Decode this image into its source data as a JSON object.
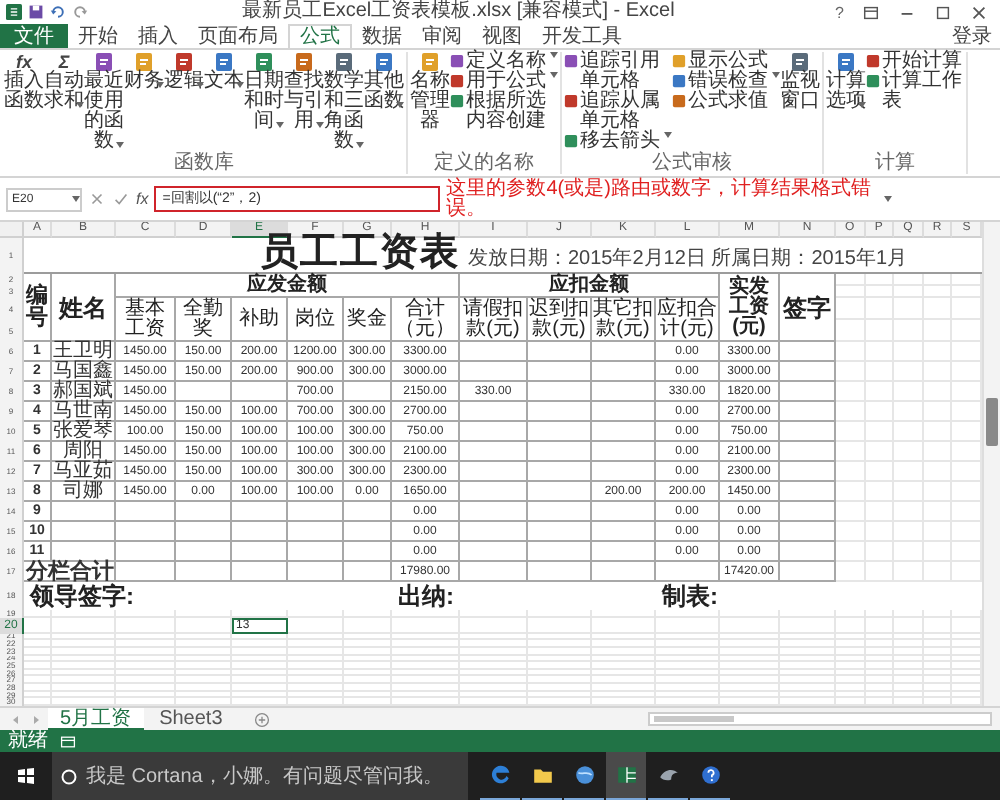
{
  "window": {
    "title": "最新员工Excel工资表模板.xlsx [兼容模式] - Excel",
    "help": "?"
  },
  "ribbon": {
    "tabs": [
      {
        "label": "文件",
        "kind": "file",
        "selected": false
      },
      {
        "label": "开始",
        "kind": "tab",
        "selected": false
      },
      {
        "label": "插入",
        "kind": "tab",
        "selected": false
      },
      {
        "label": "页面布局",
        "kind": "tab",
        "selected": false
      },
      {
        "label": "公式",
        "kind": "tab",
        "selected": true
      },
      {
        "label": "数据",
        "kind": "tab",
        "selected": false
      },
      {
        "label": "审阅",
        "kind": "tab",
        "selected": false
      },
      {
        "label": "视图",
        "kind": "tab",
        "selected": false
      },
      {
        "label": "开发工具",
        "kind": "tab",
        "selected": false
      }
    ],
    "sign_in": "登录",
    "groups": [
      {
        "label": "函数库",
        "items": [
          {
            "kind": "large",
            "label": "插入函数",
            "glyph": "fx",
            "dropdown": false
          },
          {
            "kind": "large",
            "label": "自动求和",
            "glyph": "Σ",
            "dropdown": true
          },
          {
            "kind": "large",
            "label": "最近使用的函数",
            "dropdown": true
          },
          {
            "kind": "large",
            "label": "财务",
            "dropdown": true
          },
          {
            "kind": "large",
            "label": "逻辑",
            "dropdown": true
          },
          {
            "kind": "large",
            "label": "文本",
            "dropdown": true
          },
          {
            "kind": "large",
            "label": "日期和时间",
            "dropdown": true
          },
          {
            "kind": "large",
            "label": "查找与引用",
            "dropdown": true
          },
          {
            "kind": "large",
            "label": "数学和三角函数",
            "dropdown": true
          },
          {
            "kind": "large",
            "label": "其他函数",
            "dropdown": true
          }
        ]
      },
      {
        "label": "定义的名称",
        "items": [
          {
            "kind": "large",
            "label": "名称管理器",
            "dropdown": false
          },
          {
            "kind": "small",
            "label": "定义名称",
            "dropdown": true
          },
          {
            "kind": "small",
            "label": "用于公式",
            "dropdown": true
          },
          {
            "kind": "small",
            "label": "根据所选内容创建",
            "dropdown": false
          }
        ]
      },
      {
        "label": "公式审核",
        "items": [
          {
            "kind": "small",
            "label": "追踪引用单元格",
            "dropdown": false
          },
          {
            "kind": "small",
            "label": "追踪从属单元格",
            "dropdown": false
          },
          {
            "kind": "small",
            "label": "移去箭头",
            "dropdown": true
          },
          {
            "kind": "small",
            "label": "显示公式",
            "dropdown": false
          },
          {
            "kind": "small",
            "label": "错误检查",
            "dropdown": true
          },
          {
            "kind": "small",
            "label": "公式求值",
            "dropdown": false
          },
          {
            "kind": "large",
            "label": "监视窗口",
            "dropdown": false
          }
        ]
      },
      {
        "label": "计算",
        "items": [
          {
            "kind": "large",
            "label": "计算选项",
            "dropdown": true
          },
          {
            "kind": "small",
            "label": "开始计算",
            "dropdown": false
          },
          {
            "kind": "small",
            "label": "计算工作表",
            "dropdown": false
          }
        ]
      }
    ]
  },
  "formula_bar": {
    "name_box": "E20",
    "fx": "fx",
    "formula": "=回割以(“2”，2)",
    "note": "这里的参数4(或是)路由或数字，计算结果格式错误。"
  },
  "sheet": {
    "columns": [
      {
        "label": "A",
        "selected": false
      },
      {
        "label": "B",
        "selected": false
      },
      {
        "label": "C",
        "selected": false
      },
      {
        "label": "D",
        "selected": false
      },
      {
        "label": "E",
        "selected": true
      },
      {
        "label": "F",
        "selected": false
      },
      {
        "label": "G",
        "selected": false
      },
      {
        "label": "H",
        "selected": false
      },
      {
        "label": "I",
        "selected": false
      },
      {
        "label": "J",
        "selected": false
      },
      {
        "label": "K",
        "selected": false
      },
      {
        "label": "L",
        "selected": false
      },
      {
        "label": "M",
        "selected": false
      },
      {
        "label": "N",
        "selected": false
      },
      {
        "label": "O",
        "selected": false
      },
      {
        "label": "P",
        "selected": false
      },
      {
        "label": "Q",
        "selected": false
      },
      {
        "label": "R",
        "selected": false
      },
      {
        "label": "S",
        "selected": false
      }
    ],
    "row_numbers": [
      {
        "label": "1",
        "selected": false
      },
      {
        "label": "2",
        "selected": false
      },
      {
        "label": "3",
        "selected": false
      },
      {
        "label": "4",
        "selected": false
      },
      {
        "label": "5",
        "selected": false
      },
      {
        "label": "6",
        "selected": false
      },
      {
        "label": "7",
        "selected": false
      },
      {
        "label": "8",
        "selected": false
      },
      {
        "label": "9",
        "selected": false
      },
      {
        "label": "10",
        "selected": false
      },
      {
        "label": "11",
        "selected": false
      },
      {
        "label": "12",
        "selected": false
      },
      {
        "label": "13",
        "selected": false
      },
      {
        "label": "14",
        "selected": false
      },
      {
        "label": "15",
        "selected": false
      },
      {
        "label": "16",
        "selected": false
      },
      {
        "label": "17",
        "selected": false
      },
      {
        "label": "18",
        "selected": false
      },
      {
        "label": "19",
        "selected": false
      },
      {
        "label": "20",
        "selected": true
      },
      {
        "label": "21",
        "selected": false
      },
      {
        "label": "22",
        "selected": false
      },
      {
        "label": "23",
        "selected": false
      },
      {
        "label": "24",
        "selected": false
      },
      {
        "label": "25",
        "selected": false
      },
      {
        "label": "26",
        "selected": false
      },
      {
        "label": "27",
        "selected": false
      },
      {
        "label": "28",
        "selected": false
      },
      {
        "label": "29",
        "selected": false
      },
      {
        "label": "30",
        "selected": false
      }
    ],
    "title": "员工工资表",
    "date_line": "发放日期：2015年2月12日 所属日期：2015年1月",
    "header": {
      "number": "编号",
      "name": "姓名",
      "groups": [
        {
          "label": "应发金额",
          "columns": [
            "基本工资",
            "全勤奖",
            "补助",
            "岗位",
            "奖金",
            "合计（元）"
          ]
        },
        {
          "label": "应扣金额",
          "columns": [
            "请假扣款(元)",
            "迟到扣款(元)",
            "其它扣款(元)",
            "应扣合计(元)"
          ]
        }
      ],
      "net_pay": "实发工资(元)",
      "signature": "签字"
    },
    "rows": [
      {
        "cells": [
          "1",
          "王卫明",
          "1450.00",
          "150.00",
          "200.00",
          "1200.00",
          "300.00",
          "3300.00",
          null,
          null,
          null,
          "0.00",
          "3300.00",
          null
        ]
      },
      {
        "cells": [
          "2",
          "马国鑫",
          "1450.00",
          "150.00",
          "200.00",
          "900.00",
          "300.00",
          "3000.00",
          null,
          null,
          null,
          "0.00",
          "3000.00",
          null
        ]
      },
      {
        "cells": [
          "3",
          "郝国斌",
          "1450.00",
          null,
          null,
          "700.00",
          null,
          "2150.00",
          "330.00",
          null,
          null,
          "330.00",
          "1820.00",
          null
        ]
      },
      {
        "cells": [
          "4",
          "马世南",
          "1450.00",
          "150.00",
          "100.00",
          "700.00",
          "300.00",
          "2700.00",
          null,
          null,
          null,
          "0.00",
          "2700.00",
          null
        ]
      },
      {
        "cells": [
          "5",
          "张爱琴",
          "100.00",
          "150.00",
          "100.00",
          "100.00",
          "300.00",
          "750.00",
          null,
          null,
          null,
          "0.00",
          "750.00",
          null
        ]
      },
      {
        "cells": [
          "6",
          "周阳",
          "1450.00",
          "150.00",
          "100.00",
          "100.00",
          "300.00",
          "2100.00",
          null,
          null,
          null,
          "0.00",
          "2100.00",
          null
        ]
      },
      {
        "cells": [
          "7",
          "马亚茹",
          "1450.00",
          "150.00",
          "100.00",
          "300.00",
          "300.00",
          "2300.00",
          null,
          null,
          null,
          "0.00",
          "2300.00",
          null
        ]
      },
      {
        "cells": [
          "8",
          "司娜",
          "1450.00",
          "0.00",
          "100.00",
          "100.00",
          "0.00",
          "1650.00",
          null,
          null,
          "200.00",
          "200.00",
          "1450.00",
          null
        ]
      },
      {
        "cells": [
          "9",
          null,
          null,
          null,
          null,
          null,
          null,
          "0.00",
          null,
          null,
          null,
          "0.00",
          "0.00",
          null
        ]
      },
      {
        "cells": [
          "10",
          null,
          null,
          null,
          null,
          null,
          null,
          "0.00",
          null,
          null,
          null,
          "0.00",
          "0.00",
          null
        ]
      },
      {
        "cells": [
          "11",
          null,
          null,
          null,
          null,
          null,
          null,
          "0.00",
          null,
          null,
          null,
          "0.00",
          "0.00",
          null
        ]
      }
    ],
    "totals": {
      "label": "分栏合计",
      "cells": [
        null,
        null,
        null,
        null,
        null,
        "17980.00",
        null,
        null,
        null,
        null,
        "17420.00",
        null
      ]
    },
    "signatures": [
      "领导签字:",
      "出纳:",
      "制表:"
    ],
    "active_value": "13"
  },
  "sheet_tabs": [
    {
      "label": "5月工资",
      "selected": true
    },
    {
      "label": "Sheet3",
      "selected": false
    }
  ],
  "status": "就绪",
  "taskbar": {
    "search_placeholder": "我是 Cortana，小娜。有问题尽管问我。",
    "apps": [
      {
        "selected": false
      },
      {
        "selected": false
      },
      {
        "selected": false
      },
      {
        "selected": true
      },
      {
        "selected": false
      },
      {
        "selected": false
      }
    ]
  }
}
